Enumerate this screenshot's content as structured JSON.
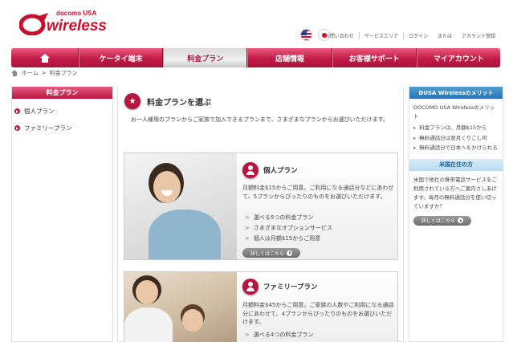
{
  "header": {
    "logo_top": "docomo USA",
    "logo_main": "wireless",
    "flags": [
      "us-flag-icon",
      "jp-flag-icon"
    ],
    "links": [
      "お問い合わせ",
      "サービスエリア",
      "ログイン",
      "または",
      "アカウント登録"
    ]
  },
  "nav": {
    "items": [
      "ケータイ端末",
      "料金プラン",
      "店舗情報",
      "お客様サポート",
      "マイアカウント"
    ],
    "active": "料金プラン"
  },
  "breadcrumb": {
    "home": "ホーム",
    "sep": ">",
    "current": "料金プラン"
  },
  "left_sidebar": {
    "title": "料金プラン",
    "items": [
      "個人プラン",
      "ファミリープラン"
    ]
  },
  "main": {
    "title": "料金プランを選ぶ",
    "intro": "お一人様用のプランからご家族で加入できるプランまで、さまざまなプランからお選びいただけます。",
    "plans": [
      {
        "title": "個人プラン",
        "desc": "月額料金$15からご用意。ご利用になる通話分などにあわせて、5プランからぴったりのものをお選びいただけます。",
        "features": [
          "選べる5つの料金プラン",
          "さまざまなオプションサービス",
          "個人は月額$15からご用意"
        ],
        "button": "詳しくはこちら"
      },
      {
        "title": "ファミリープラン",
        "desc": "月額料金$45からご用意。ご家族の人数やご利用になる通話分にあわせて、4プランからぴったりのものをお選びいただけます。",
        "features": [
          "選べる4つの料金プラン"
        ]
      }
    ]
  },
  "right_sidebar": {
    "merit_title": "DUSA Wirelessのメリット",
    "merit_intro": "DOCOMO USA Wirelessのメリット",
    "merits": [
      "料金プランは、月額$15から",
      "無料通話分は翌月くりこし可",
      "無料通話分で日本へもかけられる"
    ],
    "resident_title": "米国在住の方",
    "resident_text": "米国で他社の携帯電話サービスをご利用されている方へご案内さしあげます。毎月の無料通話分を使い切っていますか？",
    "button": "詳しくはこちら"
  },
  "colors": {
    "brand": "#c8102e",
    "nav": "#c11a45",
    "accent_blue": "#2576b3"
  }
}
